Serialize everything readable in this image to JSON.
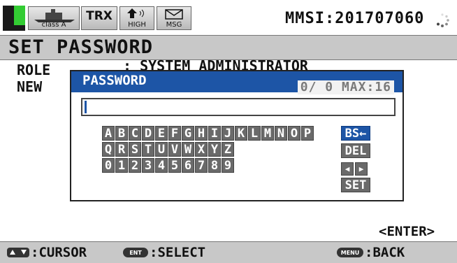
{
  "status": {
    "class_label": "class A",
    "trx_label": "TRX",
    "high_label": "HIGH",
    "msg_label": "MSG",
    "mmsi_text": "MMSI:201707060"
  },
  "title": "SET PASSWORD",
  "background": {
    "role_label": "ROLE",
    "role_value": ": SYSTEM ADMINISTRATOR",
    "new_label": "NEW"
  },
  "dialog": {
    "title": "PASSWORD",
    "counter": "0/ 0 MAX:16",
    "keyboard_rows": [
      [
        "A",
        "B",
        "C",
        "D",
        "E",
        "F",
        "G",
        "H",
        "I",
        "J",
        "K",
        "L",
        "M",
        "N",
        "O",
        "P"
      ],
      [
        "Q",
        "R",
        "S",
        "T",
        "U",
        "V",
        "W",
        "X",
        "Y",
        "Z"
      ],
      [
        "0",
        "1",
        "2",
        "3",
        "4",
        "5",
        "6",
        "7",
        "8",
        "9"
      ]
    ],
    "bs_label": "BS←",
    "del_label": "DEL",
    "set_label": "SET"
  },
  "enter_label": "<ENTER>",
  "bottom": {
    "cursor_label": ":CURSOR",
    "select_label": ":SELECT",
    "back_label": ":BACK",
    "ent_key": "ENT",
    "menu_key": "MENU"
  }
}
